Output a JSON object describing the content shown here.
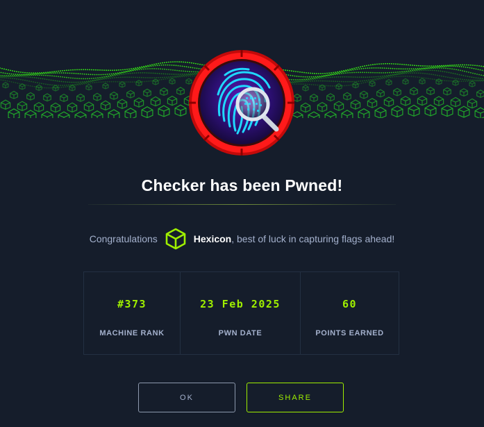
{
  "modal": {
    "title": "Checker has been Pwned!",
    "congrats_prefix": "Congratulations",
    "username": "Hexicon",
    "congrats_suffix": ", best of luck in capturing flags ahead!"
  },
  "stats": [
    {
      "value": "#373",
      "label": "MACHINE RANK"
    },
    {
      "value": "23 Feb 2025",
      "label": "PWN DATE"
    },
    {
      "value": "60",
      "label": "POINTS EARNED"
    }
  ],
  "buttons": {
    "ok_label": "OK",
    "share_label": "SHARE"
  },
  "icons": {
    "badge": "fingerprint-magnifier-badge-icon",
    "user_rank": "hackthebox-cube-icon"
  },
  "colors": {
    "accent": "#9fef00",
    "background": "#151d2b",
    "muted_text": "#a4b1cd",
    "badge_ring": "#e50e0e"
  }
}
